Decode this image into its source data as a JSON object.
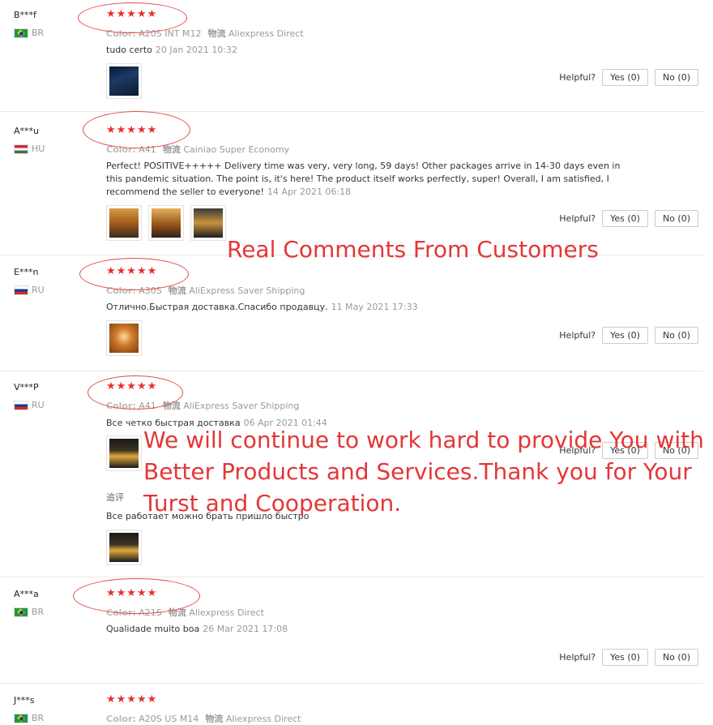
{
  "colors": {
    "stars": "#e62e2e",
    "annotation": "#e33737"
  },
  "ui": {
    "helpful_label": "Helpful?"
  },
  "reviews": [
    {
      "user": "B***f",
      "country": "BR",
      "stars": "★★★★★",
      "color_label": "Color:",
      "color": "A20S INT M12",
      "shipping_label": "物流",
      "shipping": "Aliexpress Direct",
      "text": "tudo certo",
      "date": "20 Jan 2021 10:32",
      "yes": "Yes (0)",
      "no": "No (0)",
      "images": [
        "phone"
      ]
    },
    {
      "user": "A***u",
      "country": "HU",
      "stars": "★★★★★",
      "color_label": "Color:",
      "color": "A41",
      "shipping_label": "物流",
      "shipping": "Cainiao Super Economy",
      "text": "Perfect! POSITIVE+++++ Delivery time was very, very long, 59 days! Other packages arrive in 14-30 days even in this pandemic situation. The point is, it's here! The product itself works perfectly, super! Overall, I am satisfied, I recommend the seller to everyone!",
      "date": "14 Apr 2021 06:18",
      "yes": "Yes (0)",
      "no": "No (0)",
      "images": [
        "orange1",
        "orange2",
        "dark1"
      ]
    },
    {
      "user": "E***n",
      "country": "RU",
      "stars": "★★★★★",
      "color_label": "Color:",
      "color": "A30S",
      "shipping_label": "物流",
      "shipping": "AliExpress Saver Shipping",
      "text": "Отлично.Быстрая доставка.Спасибо продавцу.",
      "date": "11 May 2021 17:33",
      "yes": "Yes (0)",
      "no": "No (0)",
      "images": [
        "warm"
      ]
    },
    {
      "user": "V***P",
      "country": "RU",
      "stars": "★★★★★",
      "color_label": "Color:",
      "color": "A41",
      "shipping_label": "物流",
      "shipping": "AliExpress Saver Shipping",
      "text": "Все четко быстрая доставка",
      "date": "06 Apr 2021 01:44",
      "yes": "Yes (0)",
      "no": "No (0)",
      "images": [
        "black"
      ],
      "append_label": "追评",
      "append_text": "Все работает можно брать пришло быстро",
      "append_images": [
        "black"
      ]
    },
    {
      "user": "A***a",
      "country": "BR",
      "stars": "★★★★★",
      "color_label": "Color:",
      "color": "A21S",
      "shipping_label": "物流",
      "shipping": "Aliexpress Direct",
      "text": "Qualidade muito boa",
      "date": "26 Mar 2021 17:08",
      "yes": "Yes (0)",
      "no": "No (0)",
      "images": []
    },
    {
      "user": "J***s",
      "country": "BR",
      "stars": "★★★★★",
      "color_label": "Color:",
      "color": "A20S US M14",
      "shipping_label": "物流",
      "shipping": "Aliexpress Direct"
    }
  ],
  "annotations": {
    "headline": "Real Comments From Customers",
    "message": "We will continue to work hard to provide You with Better Products and Services.Thank you for Your Turst and Cooperation."
  }
}
